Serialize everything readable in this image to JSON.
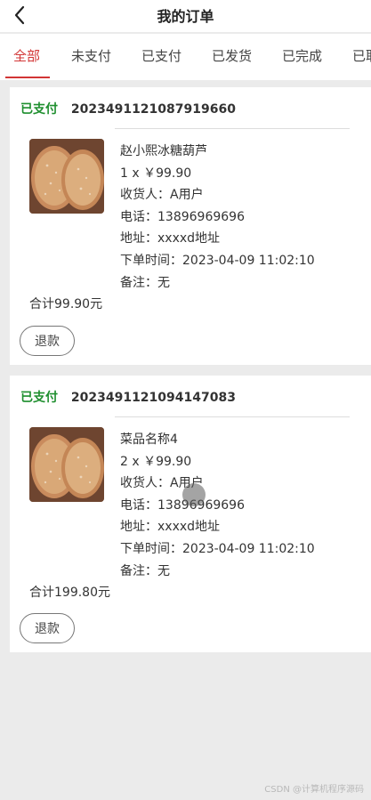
{
  "header": {
    "title": "我的订单",
    "back_icon": "chevron-left-icon"
  },
  "tabs": [
    {
      "label": "全部",
      "active": true
    },
    {
      "label": "未支付",
      "active": false
    },
    {
      "label": "已支付",
      "active": false
    },
    {
      "label": "已发货",
      "active": false
    },
    {
      "label": "已完成",
      "active": false
    },
    {
      "label": "已取",
      "active": false
    }
  ],
  "colors": {
    "accent": "#d23535",
    "status_paid": "#1f8f2f",
    "background": "#ebebeb"
  },
  "orders": [
    {
      "status": "已支付",
      "order_no": "2023491121087919660",
      "dish": "赵小熙冰糖葫芦",
      "qty_price": "1 x ￥99.90",
      "receiver": "收货人：A用户",
      "phone": "电话：13896969696",
      "address": "地址：xxxxd地址",
      "order_time": "下单时间：2023-04-09 11:02:10",
      "note": "备注：无",
      "total": "合计99.90元",
      "refund_label": "退款"
    },
    {
      "status": "已支付",
      "order_no": "2023491121094147083",
      "dish": "菜品名称4",
      "qty_price": "2 x ￥99.90",
      "receiver": "收货人：A用户",
      "phone": "电话：13896969696",
      "address": "地址：xxxxd地址",
      "order_time": "下单时间：2023-04-09 11:02:10",
      "note": "备注：无",
      "total": "合计199.80元",
      "refund_label": "退款"
    }
  ],
  "watermark": "CSDN @计算机程序源码"
}
